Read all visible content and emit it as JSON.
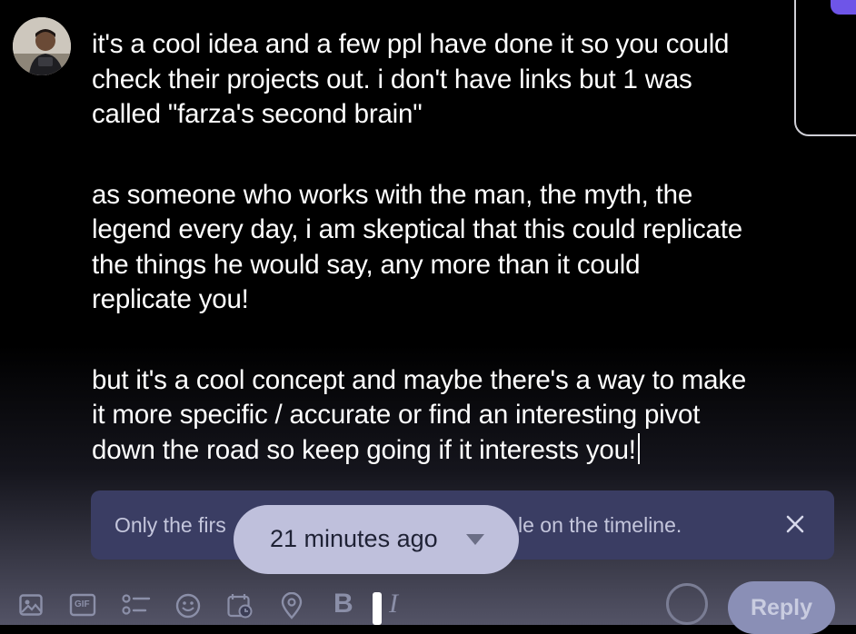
{
  "composer": {
    "avatar_alt": "user avatar",
    "paragraphs": [
      {
        "lines": [
          "it's a cool idea and a few ppl have done it so you could",
          "check their projects out. i don't have links but 1 was",
          "called \"farza's second brain\""
        ]
      },
      {
        "lines": [
          "as someone who works with the man, the myth, the",
          "legend every day, i am skeptical that this could replicate",
          "the things he would say, any more than it could",
          "replicate you!"
        ]
      },
      {
        "lines": [
          "but it's a cool concept and maybe there's a way to make",
          "it more specific / accurate or find an interesting pivot",
          "down the road so keep going if it interests you!"
        ]
      }
    ]
  },
  "notice": {
    "text_left": "Only the firs",
    "text_right": "le on the timeline."
  },
  "timestamp_pill": {
    "label": "21 minutes ago"
  },
  "toolbar": {
    "icons": [
      "image-icon",
      "gif-icon",
      "poll-icon",
      "emoji-icon",
      "schedule-icon",
      "location-icon",
      "bold-icon",
      "italic-icon"
    ],
    "bold_label": "B",
    "italic_label": "I",
    "gif_label": "GIF",
    "reply_label": "Reply"
  },
  "colors": {
    "accent": "#6e55e8",
    "notice_bg": "#3a3d63",
    "pill_bg": "#bfc0dc",
    "reply_bg": "#8a8fb6"
  }
}
